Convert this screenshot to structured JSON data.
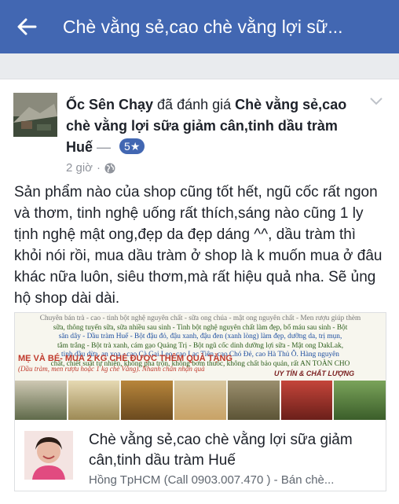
{
  "header": {
    "title": "Chè vằng sẻ,cao chè vằng lợi sữ...",
    "back_icon": "arrow-left-icon"
  },
  "post": {
    "author": "Ốc Sên Chạy",
    "action": " đã đánh giá ",
    "page_name": "Chè vằng sẻ,cao chè vằng lợi sữa giảm cân,tinh dầu tràm Huế",
    "dash": " — ",
    "rating": "5★",
    "time": "2 giờ",
    "dot": "·",
    "privacy_icon": "globe-icon",
    "body": "Sản phẩm nào của shop cũng tốt hết, ngũ cốc rất ngon và thơm, tinh nghệ uống rất thích,sáng nào cũng 1 ly tịnh nghệ mật ong,đẹp da đẹp dáng ^^, dầu tràm thì khỏi nói rồi, mua dầu tràm ở shop là k muốn mua ở đâu khác nữa luôn, siêu thơm,mà rất hiệu quả nha. Sẽ ủng hộ shop dài dài."
  },
  "link": {
    "promo_lines": [
      "Chuyên bán trà - cao - tinh bột nghệ nguyên chất - sữa ong chúa - mật ong nguyên chất - Men rượu giúp thèm",
      "sữa, thông tuyến sữa, sữa nhiều sau sinh - Tinh bột nghệ nguyên chất làm đẹp, bổ máu sau sinh - Bột",
      "săn dây - Dầu tràm Huế - Bột đậu đỏ, đậu xanh, đậu đen (xanh lòng) làm đẹp, dưỡng da, trị mụn,",
      "tắm trắng - Bột trà xanh, cám gạo Quảng Trị - Bột ngũ cốc dinh dưỡng lợi sữa - Mật ong DakLak,",
      "tinh dầu dừa, an xoa - cao Cà Gai Leo, cao Lạc Tiên, cao Chó Đẻ, cao Hà Thủ Ô. Hàng nguyên",
      "chất, chiết suất tự nhiên, không pha trộn, không bơm thuốc, không chất bảo quản, rất AN TOÀN CHO"
    ],
    "promo_banner": "MẸ VÀ BÉ- MUA 2 KG CHÈ ĐƯỢC THÊM QUÀ TẶNG",
    "promo_note": "(Dầu tràm, men rượu hoặc 1 kg chè Vằng). Nhanh chân nhận quà",
    "quality": "UY TÍN & CHẤT LƯỢNG",
    "title": "Chè vằng sẻ,cao chè vằng lợi sữa giảm cân,tinh dầu tràm Huế",
    "description": "Hồng TpHCM (Call 0903.007.470 ) - Bán chè..."
  }
}
